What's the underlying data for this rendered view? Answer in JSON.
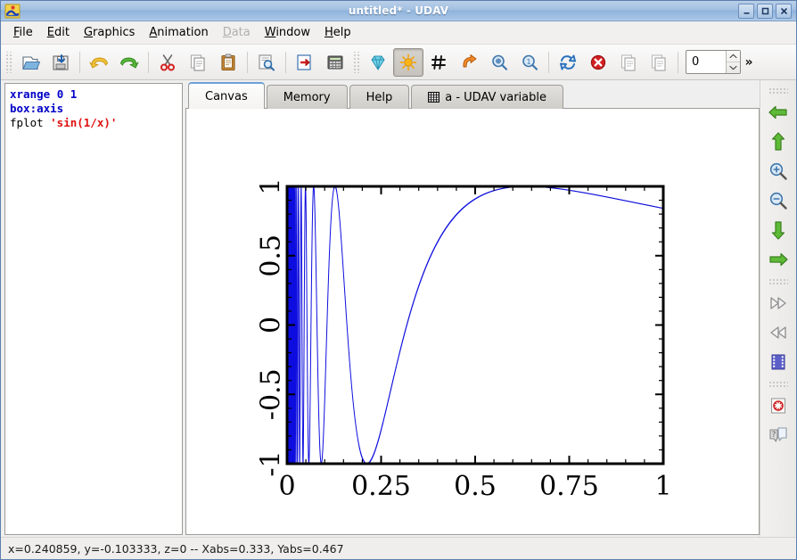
{
  "window": {
    "title": "untitled* - UDAV",
    "app_icon": "udav-app-icon",
    "buttons": {
      "minimize": "minimize-button",
      "maximize": "maximize-button",
      "close": "close-button"
    }
  },
  "menubar": {
    "items": [
      {
        "label": "File",
        "mnemonic": "F",
        "disabled": false
      },
      {
        "label": "Edit",
        "mnemonic": "E",
        "disabled": false
      },
      {
        "label": "Graphics",
        "mnemonic": "G",
        "disabled": false
      },
      {
        "label": "Animation",
        "mnemonic": "A",
        "disabled": false
      },
      {
        "label": "Data",
        "mnemonic": "D",
        "disabled": true
      },
      {
        "label": "Window",
        "mnemonic": "W",
        "disabled": false
      },
      {
        "label": "Help",
        "mnemonic": "H",
        "disabled": false
      }
    ]
  },
  "toolbar": {
    "items": [
      {
        "name": "open-icon",
        "kind": "button"
      },
      {
        "name": "save-icon",
        "kind": "button"
      },
      {
        "name": "separator",
        "kind": "separator"
      },
      {
        "name": "undo-icon",
        "kind": "button"
      },
      {
        "name": "redo-icon",
        "kind": "button"
      },
      {
        "name": "separator",
        "kind": "separator"
      },
      {
        "name": "cut-icon",
        "kind": "button"
      },
      {
        "name": "copy-icon",
        "kind": "button"
      },
      {
        "name": "paste-icon",
        "kind": "button"
      },
      {
        "name": "separator",
        "kind": "separator"
      },
      {
        "name": "find-icon",
        "kind": "button"
      },
      {
        "name": "separator",
        "kind": "separator"
      },
      {
        "name": "insert-icon",
        "kind": "button"
      },
      {
        "name": "calculator-icon",
        "kind": "button"
      },
      {
        "name": "grip",
        "kind": "grip"
      },
      {
        "name": "crystal-icon",
        "kind": "button"
      },
      {
        "name": "light-icon",
        "kind": "button",
        "active": true
      },
      {
        "name": "grid-icon",
        "kind": "button"
      },
      {
        "name": "rotate-right-icon",
        "kind": "button"
      },
      {
        "name": "zoom-fit-icon",
        "kind": "button"
      },
      {
        "name": "zoom-one-icon",
        "kind": "button"
      },
      {
        "name": "separator",
        "kind": "separator"
      },
      {
        "name": "refresh-icon",
        "kind": "button"
      },
      {
        "name": "stop-icon",
        "kind": "button"
      },
      {
        "name": "copy-plot-icon",
        "kind": "button"
      },
      {
        "name": "copy-plot2-icon",
        "kind": "button"
      },
      {
        "name": "separator",
        "kind": "separator"
      }
    ],
    "spinbox": {
      "name": "slice-spinbox",
      "value": "0"
    },
    "overflow_label": "»"
  },
  "editor": {
    "name": "script-editor",
    "lines": [
      {
        "parts": [
          {
            "t": "xrange",
            "c": "kw"
          },
          {
            "t": " ",
            "c": "cmd"
          },
          {
            "t": "0 1",
            "c": "num"
          }
        ]
      },
      {
        "parts": [
          {
            "t": "box:axis",
            "c": "kw"
          }
        ]
      },
      {
        "parts": [
          {
            "t": "fplot ",
            "c": "cmd"
          },
          {
            "t": "'sin(1/x)'",
            "c": "str"
          }
        ]
      }
    ],
    "plain_text": "xrange 0 1\nbox:axis\nfplot 'sin(1/x)'"
  },
  "tabs": [
    {
      "label": "Canvas",
      "selected": true,
      "icon": null
    },
    {
      "label": "Memory",
      "selected": false,
      "icon": null
    },
    {
      "label": "Help",
      "selected": false,
      "icon": null
    },
    {
      "label": "a - UDAV variable",
      "selected": false,
      "icon": "table-icon"
    }
  ],
  "right_toolbar": {
    "items": [
      {
        "name": "grip",
        "kind": "grip"
      },
      {
        "name": "arrow-left-icon",
        "kind": "button"
      },
      {
        "name": "arrow-up-icon",
        "kind": "button"
      },
      {
        "name": "zoom-in-icon",
        "kind": "button"
      },
      {
        "name": "zoom-out-icon",
        "kind": "button"
      },
      {
        "name": "arrow-down-icon",
        "kind": "button"
      },
      {
        "name": "arrow-right-icon",
        "kind": "button"
      },
      {
        "name": "grip",
        "kind": "grip"
      },
      {
        "name": "fast-forward-icon",
        "kind": "button"
      },
      {
        "name": "rewind-icon",
        "kind": "button"
      },
      {
        "name": "film-icon",
        "kind": "button"
      },
      {
        "name": "grip",
        "kind": "grip"
      },
      {
        "name": "help-circle-icon",
        "kind": "button"
      },
      {
        "name": "what-is-this-icon",
        "kind": "button"
      }
    ]
  },
  "statusbar": {
    "text": "x=0.240859, y=-0.103333, z=0  --  Xabs=0.333, Yabs=0.467"
  },
  "chart_data": {
    "type": "line",
    "title": "",
    "xlabel": "",
    "ylabel": "",
    "expression": "sin(1/x)",
    "xlim": [
      0,
      1
    ],
    "ylim": [
      -1,
      1
    ],
    "xticks": [
      "0",
      "0.25",
      "0.5",
      "0.75",
      "1"
    ],
    "xtick_values": [
      0,
      0.25,
      0.5,
      0.75,
      1
    ],
    "yticks": [
      "-1",
      "-0.5",
      "0",
      "0.5",
      "1"
    ],
    "ytick_values": [
      -1,
      -0.5,
      0,
      0.5,
      1
    ],
    "grid": false,
    "legend": null,
    "line_color": "#0000dd",
    "frame_color": "#000000",
    "series": [
      {
        "name": "sin(1/x)",
        "color": "#0000dd"
      }
    ]
  }
}
